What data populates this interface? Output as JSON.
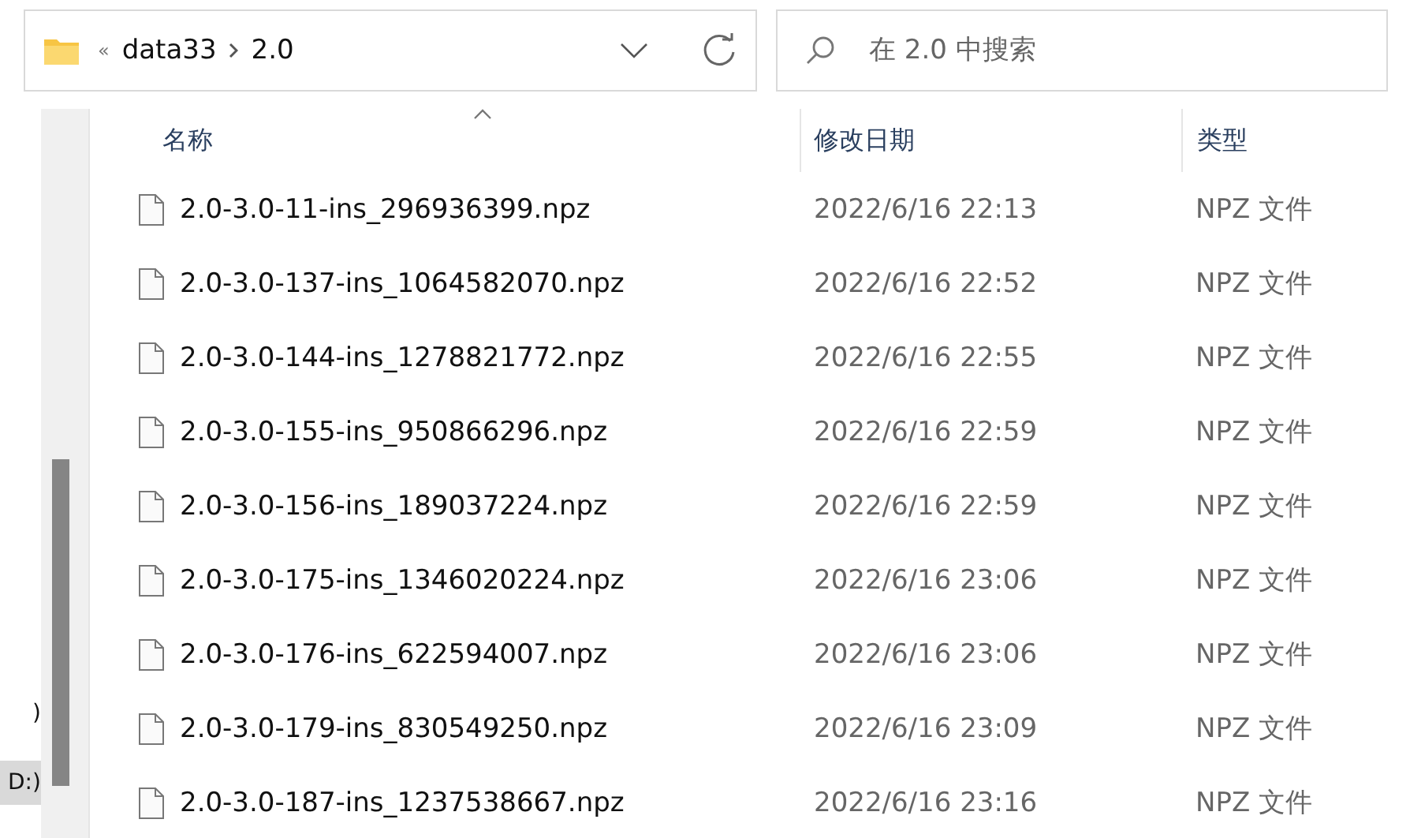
{
  "address_bar": {
    "overflow": "«",
    "path": [
      "data33",
      "2.0"
    ]
  },
  "search": {
    "placeholder": "在 2.0 中搜索"
  },
  "sidebar": {
    "items": [
      {
        "label": ")",
        "selected": false
      },
      {
        "label": "D:)",
        "selected": true
      }
    ]
  },
  "table": {
    "columns": [
      "名称",
      "修改日期",
      "类型"
    ],
    "rows": [
      {
        "name": "2.0-3.0-11-ins_296936399.npz",
        "date": "2022/6/16 22:13",
        "type": "NPZ 文件"
      },
      {
        "name": "2.0-3.0-137-ins_1064582070.npz",
        "date": "2022/6/16 22:52",
        "type": "NPZ 文件"
      },
      {
        "name": "2.0-3.0-144-ins_1278821772.npz",
        "date": "2022/6/16 22:55",
        "type": "NPZ 文件"
      },
      {
        "name": "2.0-3.0-155-ins_950866296.npz",
        "date": "2022/6/16 22:59",
        "type": "NPZ 文件"
      },
      {
        "name": "2.0-3.0-156-ins_189037224.npz",
        "date": "2022/6/16 22:59",
        "type": "NPZ 文件"
      },
      {
        "name": "2.0-3.0-175-ins_1346020224.npz",
        "date": "2022/6/16 23:06",
        "type": "NPZ 文件"
      },
      {
        "name": "2.0-3.0-176-ins_622594007.npz",
        "date": "2022/6/16 23:06",
        "type": "NPZ 文件"
      },
      {
        "name": "2.0-3.0-179-ins_830549250.npz",
        "date": "2022/6/16 23:09",
        "type": "NPZ 文件"
      },
      {
        "name": "2.0-3.0-187-ins_1237538667.npz",
        "date": "2022/6/16 23:16",
        "type": "NPZ 文件"
      }
    ]
  }
}
